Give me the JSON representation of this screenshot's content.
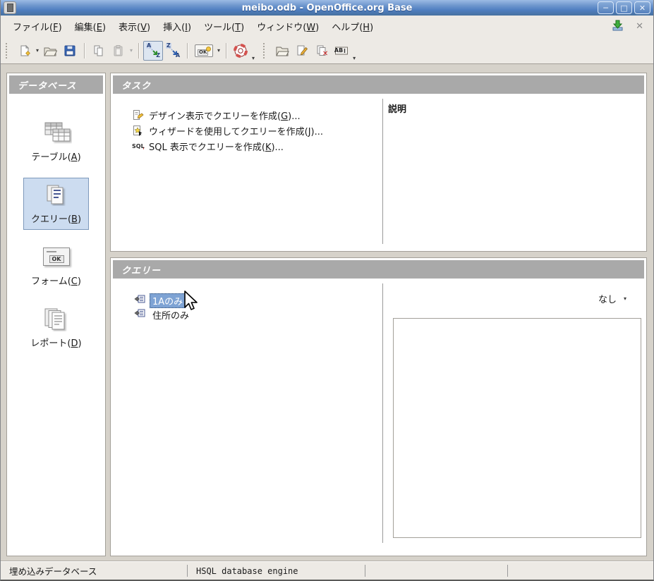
{
  "window": {
    "title": "meibo.odb - OpenOffice.org Base",
    "controls": {
      "minimize_glyph": "─",
      "maximize_glyph": "□",
      "close_glyph": "✕"
    }
  },
  "menubar": {
    "items": [
      {
        "pre": "ファイル(",
        "key": "F",
        "post": ")"
      },
      {
        "pre": "編集(",
        "key": "E",
        "post": ")"
      },
      {
        "pre": "表示(",
        "key": "V",
        "post": ")"
      },
      {
        "pre": "挿入(",
        "key": "I",
        "post": ")"
      },
      {
        "pre": "ツール(",
        "key": "T",
        "post": ")"
      },
      {
        "pre": "ウィンドウ(",
        "key": "W",
        "post": ")"
      },
      {
        "pre": "ヘルプ(",
        "key": "H",
        "post": ")"
      }
    ],
    "close_doc_glyph": "✕"
  },
  "toolbar": {
    "buttons": [
      "new-document",
      "open",
      "save",
      "copy",
      "paste",
      "sort-ascending",
      "sort-descending",
      "form-ok",
      "help-lifebuoy",
      "open-database-object",
      "edit-object",
      "delete-object",
      "rename-object"
    ],
    "caret_glyph": "▾",
    "ok_label": "OK",
    "sort_asc": {
      "top": "A",
      "bottom": "Z",
      "arrow": "↘"
    },
    "sort_desc": {
      "top": "Z",
      "bottom": "A",
      "arrow": "↘"
    },
    "rename_label": "AB",
    "delete_x_glyph": "✕"
  },
  "sidebar": {
    "header": "データベース",
    "items": [
      {
        "pre": "テーブル(",
        "key": "A",
        "post": ")"
      },
      {
        "pre": "クエリー(",
        "key": "B",
        "post": ")"
      },
      {
        "pre": "フォーム(",
        "key": "C",
        "post": ")"
      },
      {
        "pre": "レポート(",
        "key": "D",
        "post": ")"
      }
    ],
    "selected_index": 1,
    "form_icon_label": "OK"
  },
  "tasks": {
    "header": "タスク",
    "items": [
      {
        "pre": "デザイン表示でクエリーを作成(",
        "key": "G",
        "post": ")..."
      },
      {
        "pre": "ウィザードを使用してクエリーを作成(",
        "key": "J",
        "post": ")..."
      },
      {
        "pre": "SQL 表示でクエリーを作成(",
        "key": "K",
        "post": ")..."
      }
    ],
    "sql_icon_label": "SQL",
    "description_header": "説明",
    "description_text": ""
  },
  "queries": {
    "header": "クエリー",
    "items": [
      {
        "label": "1Aのみ",
        "selected": true
      },
      {
        "label": "住所のみ",
        "selected": false
      }
    ],
    "preview_selector": "なし",
    "caret_glyph": "▾"
  },
  "statusbar": {
    "cells": [
      "埋め込みデータベース",
      "HSQL database engine",
      "",
      ""
    ]
  },
  "colors": {
    "titlebar_top": "#9cbbe4",
    "titlebar_bottom": "#47719f",
    "panel_header_bg": "#a9a9a9",
    "selection_bg": "#7ea3d4",
    "sidebar_selection_bg": "#ccdcf0",
    "sidebar_selection_border": "#7d99bb",
    "chrome_bg": "#edeae5",
    "desktop_bg": "#d6d2ca"
  }
}
